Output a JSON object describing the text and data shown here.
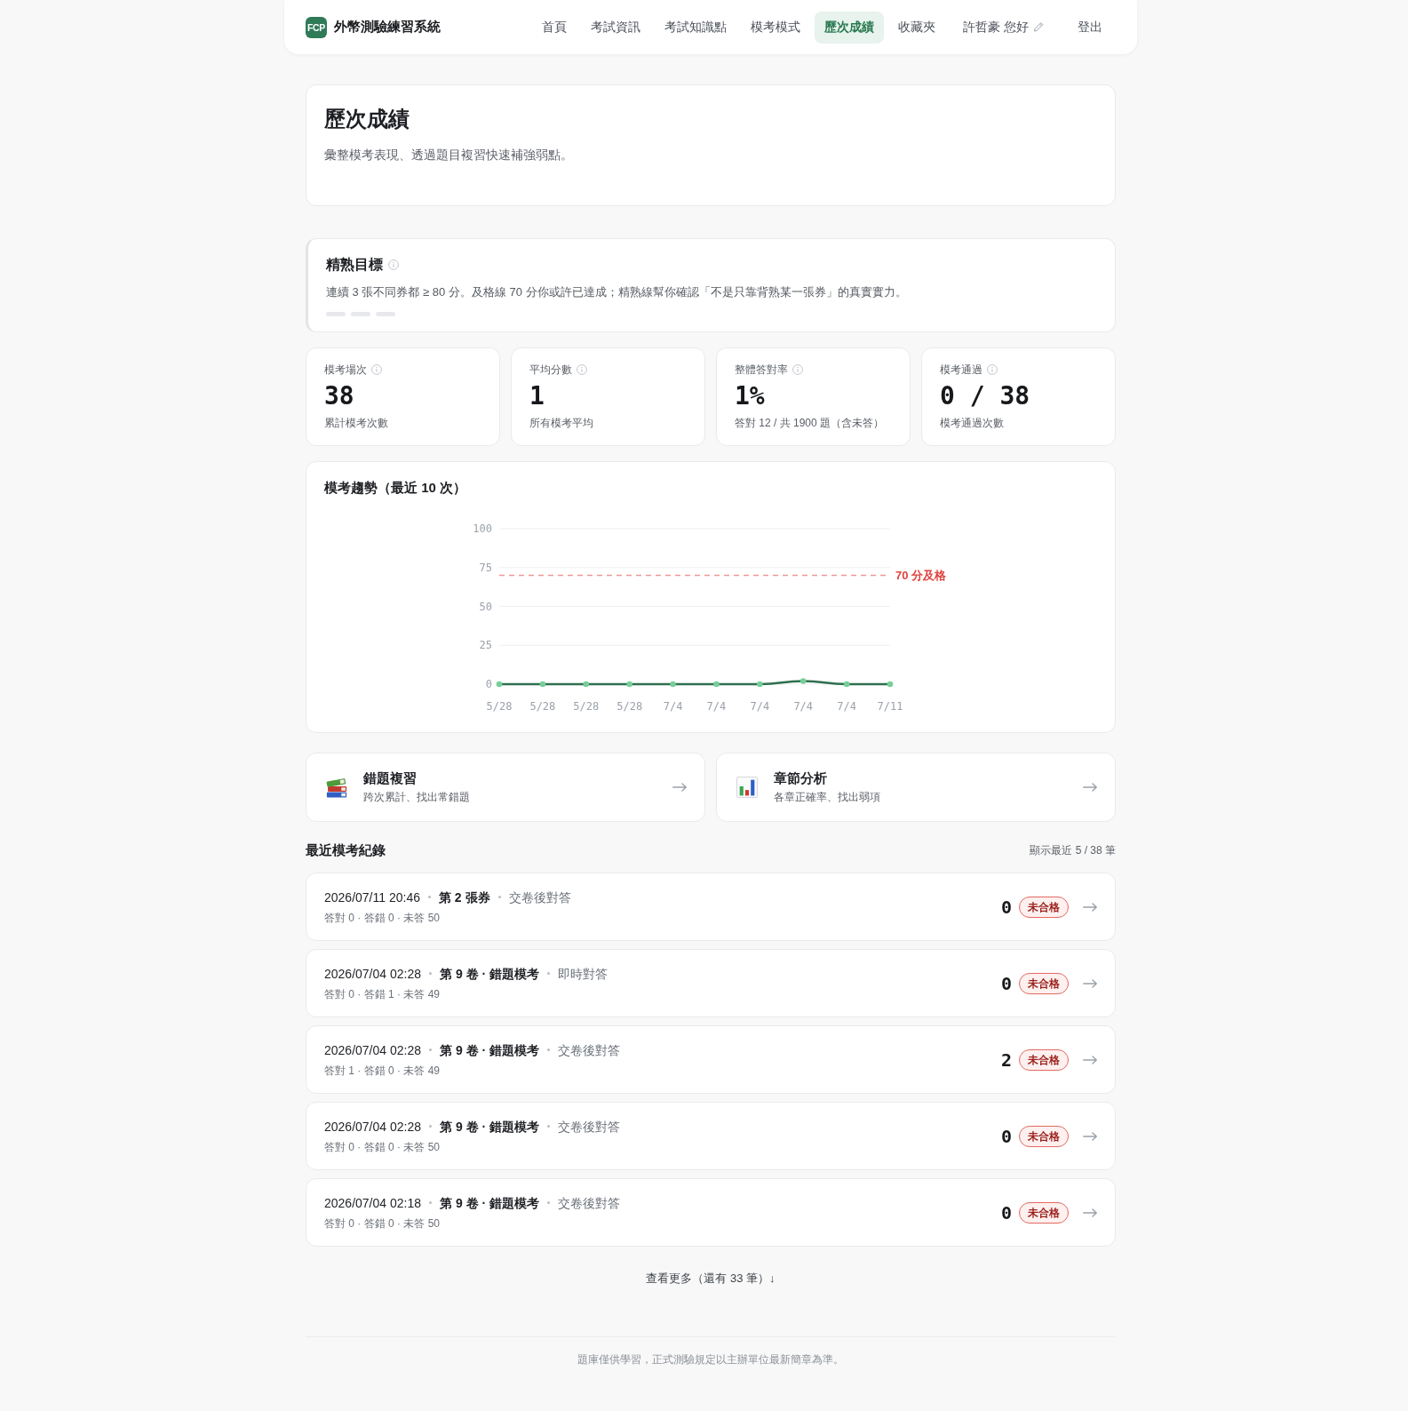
{
  "header": {
    "logo": "FCP",
    "title": "外幣測驗練習系統",
    "nav": [
      {
        "label": "首頁",
        "selected": false
      },
      {
        "label": "考試資訊",
        "selected": false
      },
      {
        "label": "考試知識點",
        "selected": false
      },
      {
        "label": "模考模式",
        "selected": false
      },
      {
        "label": "歷次成績",
        "selected": true
      },
      {
        "label": "收藏夾",
        "selected": false
      }
    ],
    "user": "許哲豪 您好",
    "logout": "登出"
  },
  "hero": {
    "title": "歷次成績",
    "subtitle": "彙整模考表現、透過題目複習快速補強弱點。"
  },
  "mastery": {
    "title": "精熟目標",
    "description": "連續 3 張不同券都 ≥ 80 分。及格線 70 分你或許已達成；精熟線幫你確認「不是只靠背熟某一張券」的真實實力。",
    "steps": [
      {
        "done": false
      },
      {
        "done": false
      },
      {
        "done": false
      }
    ]
  },
  "stats": [
    {
      "label": "模考場次",
      "value": "38",
      "note": "累計模考次數"
    },
    {
      "label": "平均分數",
      "value": "1",
      "note": "所有模考平均"
    },
    {
      "label": "整體答對率",
      "value": "1%",
      "note": "答對 12 / 共 1900 題（含未答）"
    },
    {
      "label": "模考通過",
      "value": "0 / 38",
      "note": "模考通過次數"
    }
  ],
  "trend": {
    "title": "模考趨勢（最近 10 次）",
    "chart_data": {
      "type": "line",
      "categories": [
        "5/28",
        "5/28",
        "5/28",
        "5/28",
        "7/4",
        "7/4",
        "7/4",
        "7/4",
        "7/4",
        "7/11"
      ],
      "series": [
        {
          "color": "#2f6f4f",
          "marker": "circle",
          "values": [
            0,
            0,
            0,
            0,
            0,
            0,
            0,
            2,
            0,
            0
          ]
        }
      ],
      "ylim": [
        0,
        100
      ],
      "yticks": [
        0,
        25,
        50,
        75,
        100
      ],
      "grid": true,
      "ref_lines": [
        {
          "axis": "y",
          "value": 70,
          "label": "70 分及格",
          "color": "#e0443e"
        }
      ]
    }
  },
  "shortcuts": [
    {
      "kind": "books",
      "title": "錯題複習",
      "subtitle": "跨次累計、找出常錯題"
    },
    {
      "kind": "chart",
      "title": "章節分析",
      "subtitle": "各章正確率、找出弱項"
    }
  ],
  "records": {
    "title": "最近模考紀錄",
    "count": "顯示最近 5 / 38 筆",
    "rows": [
      {
        "date": "2026/07/11 20:46",
        "paper": "第 2 張券",
        "mode": "交卷後對答",
        "summary": "答對 0 · 答錯 0 · 未答 50",
        "score": "0",
        "status": "未合格",
        "passed": false
      },
      {
        "date": "2026/07/04 02:28",
        "paper": "第 9 卷 · 錯題模考",
        "mode": "即時對答",
        "summary": "答對 0 · 答錯 1 · 未答 49",
        "score": "0",
        "status": "未合格",
        "passed": false
      },
      {
        "date": "2026/07/04 02:28",
        "paper": "第 9 卷 · 錯題模考",
        "mode": "交卷後對答",
        "summary": "答對 1 · 答錯 0 · 未答 49",
        "score": "2",
        "status": "未合格",
        "passed": false
      },
      {
        "date": "2026/07/04 02:28",
        "paper": "第 9 卷 · 錯題模考",
        "mode": "交卷後對答",
        "summary": "答對 0 · 答錯 0 · 未答 50",
        "score": "0",
        "status": "未合格",
        "passed": false
      },
      {
        "date": "2026/07/04 02:18",
        "paper": "第 9 卷 · 錯題模考",
        "mode": "交卷後對答",
        "summary": "答對 0 · 答錯 0 · 未答 50",
        "score": "0",
        "status": "未合格",
        "passed": false
      }
    ],
    "more": "查看更多（還有 33 筆）↓"
  },
  "footer": "題庫僅供學習，正式測驗規定以主辦單位最新簡章為準。"
}
